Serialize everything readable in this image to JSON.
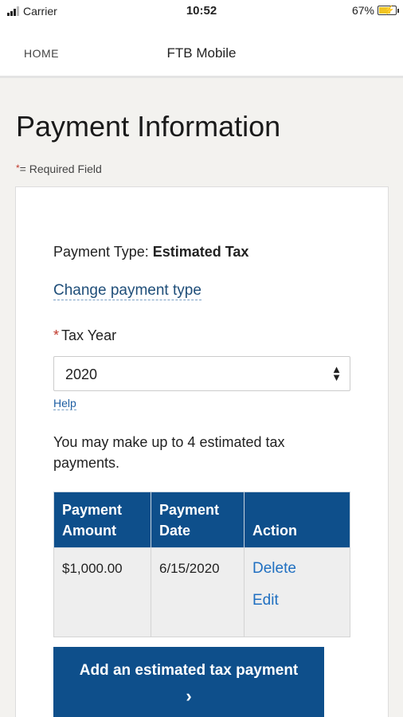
{
  "status_bar": {
    "carrier": "Carrier",
    "time": "10:52",
    "battery": "67%"
  },
  "nav": {
    "home": "HOME",
    "title": "FTB Mobile"
  },
  "page": {
    "title": "Payment Information",
    "required_note": "= Required Field",
    "required_star": "*"
  },
  "form": {
    "payment_type_label": "Payment Type: ",
    "payment_type_value": "Estimated Tax",
    "change_link": "Change payment type",
    "tax_year_label": "Tax Year",
    "tax_year_value": "2020",
    "help_link": "Help",
    "note": "You may make up to 4 estimated tax payments."
  },
  "table": {
    "headers": [
      "Payment Amount",
      "Payment Date",
      "Action"
    ],
    "rows": [
      {
        "amount": "$1,000.00",
        "date": "6/15/2020",
        "actions": [
          "Delete",
          "Edit"
        ]
      }
    ]
  },
  "add_button": {
    "label": "Add an estimated tax payment",
    "chevron": "›"
  },
  "colors": {
    "primary": "#0e4f8b",
    "link": "#1f6fc1",
    "required": "#c0392b",
    "background": "#f3f2ef"
  },
  "icons": {
    "select_caret": "sort-icon",
    "button_chevron": "chevron-right-icon",
    "signal": "signal-icon",
    "battery": "battery-charging-icon"
  }
}
